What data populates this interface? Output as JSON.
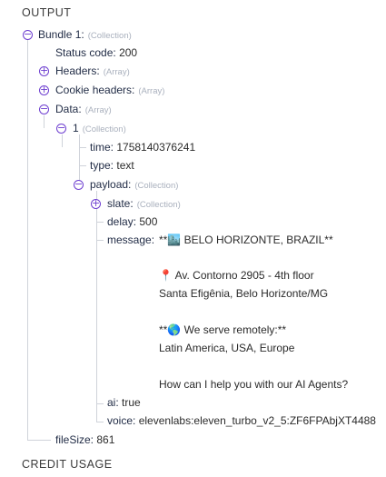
{
  "headers": {
    "output": "OUTPUT",
    "credit": "CREDIT USAGE"
  },
  "bundle": {
    "key": "Bundle 1:",
    "type": "(Collection)"
  },
  "status": {
    "key": "Status code:",
    "value": "200"
  },
  "headers_item": {
    "key": "Headers:",
    "type": "(Array)"
  },
  "cookies": {
    "key": "Cookie headers:",
    "type": "(Array)"
  },
  "data": {
    "key": "Data:",
    "type": "(Array)"
  },
  "item1": {
    "key": "1",
    "type": "(Collection)"
  },
  "time": {
    "key": "time:",
    "value": "1758140376241"
  },
  "typ": {
    "key": "type:",
    "value": "text"
  },
  "payload": {
    "key": "payload:",
    "type": "(Collection)"
  },
  "slate": {
    "key": "slate:",
    "type": "(Collection)"
  },
  "delay": {
    "key": "delay:",
    "value": "500"
  },
  "message": {
    "key": "message:",
    "line1": "**🏙️ BELO HORIZONTE, BRAZIL**",
    "line2": "📍 Av. Contorno 2905 - 4th floor",
    "line3": "Santa Efigênia, Belo Horizonte/MG",
    "line4": "**🌎 We serve remotely:**",
    "line5": "Latin America, USA, Europe",
    "line6": "How can I help you with our AI Agents?"
  },
  "ai": {
    "key": "ai:",
    "value": "true"
  },
  "voice": {
    "key": "voice:",
    "value": "elevenlabs:eleven_turbo_v2_5:ZF6FPAbjXT4488"
  },
  "filesize": {
    "key": "fileSize:",
    "value": "861"
  },
  "icons": {
    "collapse": "minus-circle-icon",
    "expand": "plus-circle-icon"
  },
  "colors": {
    "toggle": "#6e3fd0",
    "tree_line": "#cfd3da",
    "type_hint": "#a9b0bd"
  }
}
